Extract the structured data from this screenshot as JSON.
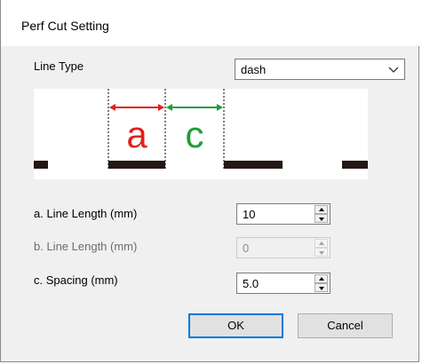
{
  "window": {
    "title": "Perf Cut Setting"
  },
  "line_type": {
    "label": "Line Type",
    "selected": "dash"
  },
  "preview": {
    "marker_a": "a",
    "marker_c": "c",
    "colors": {
      "a_arrow": "#e02020",
      "c_arrow": "#1e9e3a",
      "dash": "#231815",
      "guide": "#555555"
    }
  },
  "fields": {
    "a_length": {
      "label": "a. Line Length (mm)",
      "value": "10",
      "enabled": true
    },
    "b_length": {
      "label": "b. Line Length (mm)",
      "value": "0",
      "enabled": false
    },
    "c_spacing": {
      "label": "c. Spacing (mm)",
      "value": "5.0",
      "enabled": true
    }
  },
  "buttons": {
    "ok_label": "OK",
    "cancel_label": "Cancel"
  },
  "icons": {
    "dropdown": "chevron-down-icon",
    "spin_up": "spin-up-icon",
    "spin_down": "spin-down-icon"
  }
}
